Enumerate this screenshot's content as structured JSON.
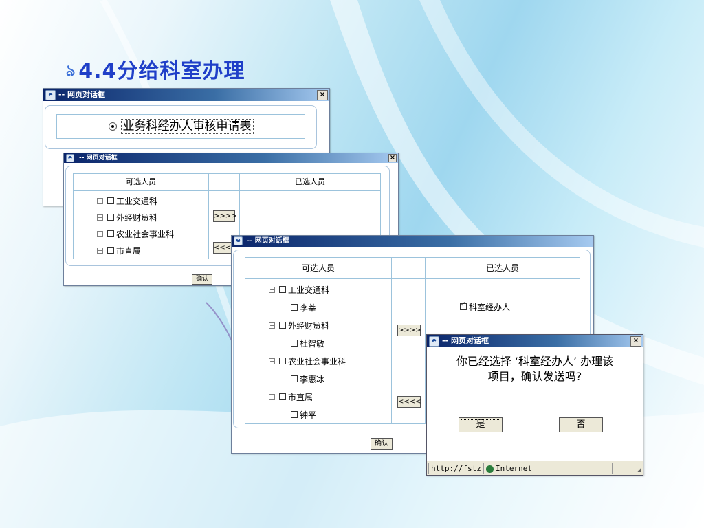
{
  "slide": {
    "title": "4.4分给科室办理"
  },
  "dialog1": {
    "title": "-- 网页对话框",
    "option_label": "业务科经办人审核申请表"
  },
  "dialog2": {
    "title": "-- 网页对话框",
    "col_available": "可选人员",
    "col_selected": "已选人员",
    "tree": [
      "工业交通科",
      "外经财贸科",
      "农业社会事业科",
      "市直属"
    ],
    "add_button": ">>>>",
    "remove_button": "<<<<",
    "confirm_button": "确认"
  },
  "dialog3": {
    "title": "-- 网页对话框",
    "col_available": "可选人员",
    "col_selected": "已选人员",
    "tree": [
      {
        "dept": "工业交通科",
        "person": "李莘"
      },
      {
        "dept": "外经财贸科",
        "person": "杜智敏"
      },
      {
        "dept": "农业社会事业科",
        "person": "李惠冰"
      },
      {
        "dept": "市直属",
        "person": "钟平"
      }
    ],
    "selected_item": "科室经办人",
    "add_button": ">>>>",
    "remove_button": "<<<<",
    "confirm_button": "确认"
  },
  "dialog4": {
    "title": "-- 网页对话框",
    "message_line1": "你已经选择 ‘科室经办人’ 办理该",
    "message_line2": "项目，确认发送吗?",
    "yes_button": "是",
    "no_button": "否",
    "status_url": "http://fstz.",
    "status_zone": "Internet"
  }
}
